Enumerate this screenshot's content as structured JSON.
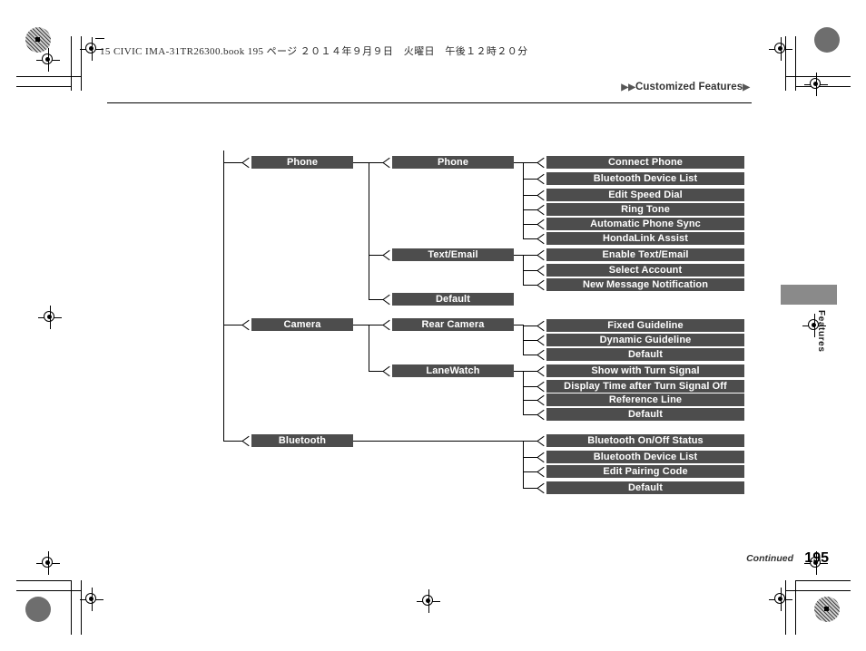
{
  "page": {
    "running_head": "15 CIVIC IMA-31TR26300.book  195 ページ  ２０１４年９月９日　火曜日　午後１２時２０分",
    "chapter_title": "Customized Features",
    "chapter_marker_left": "▶▶",
    "chapter_marker_right": "▶",
    "side_tab_label": "Features",
    "footer_continued": "Continued",
    "page_number": "195"
  },
  "colors": {
    "node_fill": "#4d4d4d",
    "node_text": "#ffffff",
    "line": "#000000",
    "side_tab": "#8a8a8a"
  },
  "tree": {
    "level1": [
      {
        "id": "phone",
        "label": "Phone"
      },
      {
        "id": "camera",
        "label": "Camera"
      },
      {
        "id": "bluetooth",
        "label": "Bluetooth"
      }
    ],
    "level2": [
      {
        "id": "phone-phone",
        "label": "Phone",
        "parent": "phone"
      },
      {
        "id": "phone-textemail",
        "label": "Text/Email",
        "parent": "phone"
      },
      {
        "id": "phone-default",
        "label": "Default",
        "parent": "phone"
      },
      {
        "id": "camera-rear",
        "label": "Rear Camera",
        "parent": "camera"
      },
      {
        "id": "camera-lanewatch",
        "label": "LaneWatch",
        "parent": "camera"
      }
    ],
    "level3": [
      {
        "id": "connect-phone",
        "label": "Connect Phone",
        "parent": "phone-phone"
      },
      {
        "id": "bt-device-list-1",
        "label": "Bluetooth Device List",
        "parent": "phone-phone"
      },
      {
        "id": "edit-speed-dial",
        "label": "Edit Speed Dial",
        "parent": "phone-phone"
      },
      {
        "id": "ring-tone",
        "label": "Ring Tone",
        "parent": "phone-phone"
      },
      {
        "id": "auto-phone-sync",
        "label": "Automatic Phone Sync",
        "parent": "phone-phone"
      },
      {
        "id": "hondalink-assist",
        "label": "HondaLink Assist",
        "parent": "phone-phone"
      },
      {
        "id": "enable-text-email",
        "label": "Enable Text/Email",
        "parent": "phone-textemail"
      },
      {
        "id": "select-account",
        "label": "Select Account",
        "parent": "phone-textemail"
      },
      {
        "id": "new-message-notification",
        "label": "New Message Notification",
        "parent": "phone-textemail"
      },
      {
        "id": "fixed-guideline",
        "label": "Fixed Guideline",
        "parent": "camera-rear"
      },
      {
        "id": "dynamic-guideline",
        "label": "Dynamic Guideline",
        "parent": "camera-rear"
      },
      {
        "id": "rear-default",
        "label": "Default",
        "parent": "camera-rear"
      },
      {
        "id": "show-with-turn-signal",
        "label": "Show with Turn Signal",
        "parent": "camera-lanewatch"
      },
      {
        "id": "display-time-after-turn-signal-off",
        "label": "Display Time after Turn Signal Off",
        "parent": "camera-lanewatch"
      },
      {
        "id": "reference-line",
        "label": "Reference Line",
        "parent": "camera-lanewatch"
      },
      {
        "id": "lanewatch-default",
        "label": "Default",
        "parent": "camera-lanewatch"
      },
      {
        "id": "bt-onoff-status",
        "label": "Bluetooth On/Off Status",
        "parent": "bluetooth"
      },
      {
        "id": "bt-device-list-2",
        "label": "Bluetooth Device List",
        "parent": "bluetooth"
      },
      {
        "id": "edit-pairing-code",
        "label": "Edit Pairing Code",
        "parent": "bluetooth"
      },
      {
        "id": "bt-default",
        "label": "Default",
        "parent": "bluetooth"
      }
    ]
  }
}
